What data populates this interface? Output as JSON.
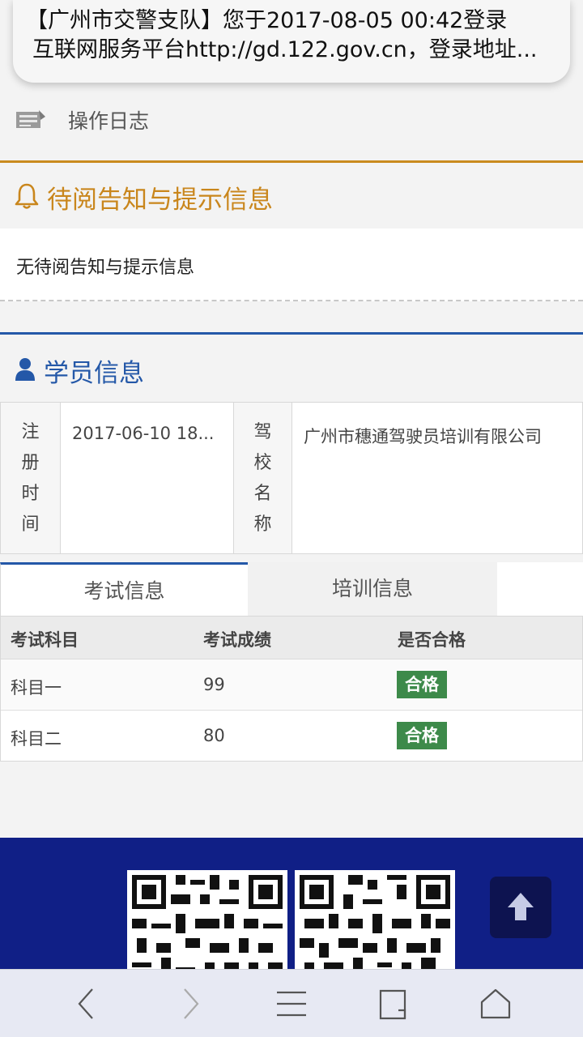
{
  "notification": {
    "line1": "【广州市交警支队】您于2017-08-05 00:42登录",
    "line2": "互联网服务平台http://gd.122.gov.cn，登录地址..."
  },
  "log": {
    "label": "操作日志",
    "icon": "notebook-icon"
  },
  "notice": {
    "title": "待阅告知与提示信息",
    "body": "无待阅告知与提示信息",
    "accent": "#c9861c"
  },
  "student": {
    "title": "学员信息",
    "accent": "#2458a8",
    "fields": [
      {
        "label": "注册时间",
        "value": "2017-06-10 18..."
      },
      {
        "label": "驾校名称",
        "value": "广州市穗通驾驶员培训有限公司"
      }
    ]
  },
  "tabs": [
    {
      "label": "考试信息",
      "active": true
    },
    {
      "label": "培训信息",
      "active": false
    }
  ],
  "exam": {
    "columns": [
      "考试科目",
      "考试成绩",
      "是否合格"
    ],
    "rows": [
      {
        "subject": "科目一",
        "score": "99",
        "status": "合格"
      },
      {
        "subject": "科目二",
        "score": "80",
        "status": "合格"
      }
    ],
    "pass_color": "#3d8a4a"
  },
  "footer": {
    "background": "#101f86",
    "qr_codes": [
      "qr-code-traffic-app",
      "qr-code-tmri"
    ]
  },
  "browser_bar": {
    "buttons": [
      "back-icon",
      "forward-icon",
      "menu-icon",
      "tabs-icon",
      "home-icon"
    ]
  }
}
